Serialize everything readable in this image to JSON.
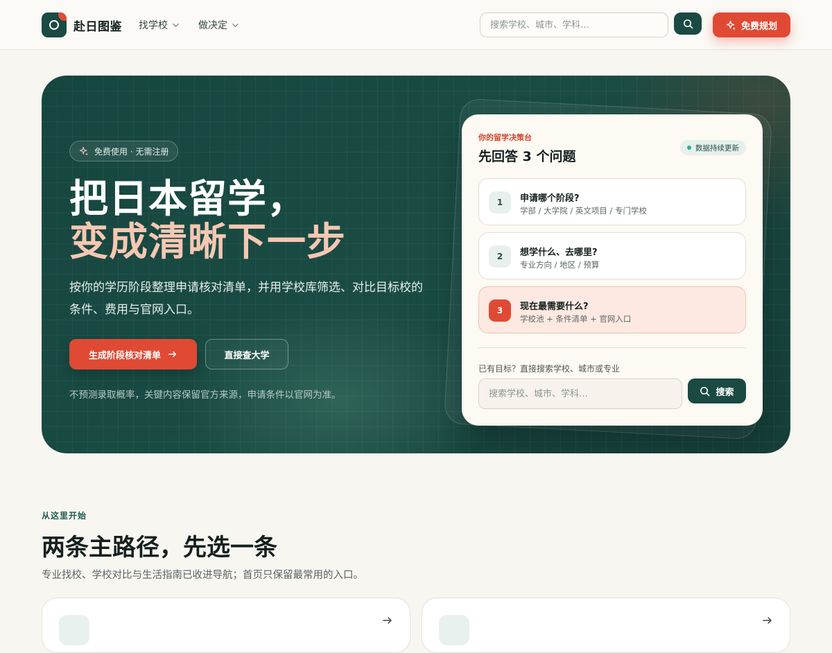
{
  "header": {
    "brand": "赴日图鉴",
    "nav": [
      {
        "label": "找学校"
      },
      {
        "label": "做决定"
      }
    ],
    "search_placeholder": "搜索学校、城市、学科…",
    "cta_label": "免费规划"
  },
  "hero": {
    "pill_text": "免费使用 · 无需注册",
    "title_line1": "把日本留学，",
    "title_line2": "变成清晰下一步",
    "description": "按你的学历阶段整理申请核对清单，并用学校库筛选、对比目标校的条件、费用与官网入口。",
    "primary_button": "生成阶段核对清单",
    "secondary_button": "直接查大学",
    "note": "不预测录取概率，关键内容保留官方来源，申请条件以官网为准。"
  },
  "decision_card": {
    "kicker": "你的留学决策台",
    "title": "先回答 3 个问题",
    "badge": "数据持续更新",
    "steps": [
      {
        "num": "1",
        "title": "申请哪个阶段?",
        "sub": "学部 / 大学院 / 英文项目 / 专门学校"
      },
      {
        "num": "2",
        "title": "想学什么、去哪里?",
        "sub": "专业方向 / 地区 / 预算"
      },
      {
        "num": "3",
        "title": "现在最需要什么?",
        "sub": "学校池 + 条件清单 + 官网入口"
      }
    ],
    "hint": "已有目标？直接搜索学校、城市或专业",
    "search_placeholder": "搜索学校、城市、学科…",
    "search_button": "搜索"
  },
  "section": {
    "kicker": "从这里开始",
    "title": "两条主路径，先选一条",
    "subtitle": "专业找校、学校对比与生活指南已收进导航；首页只保留最常用的入口。"
  },
  "colors": {
    "brand_green": "#1a4a42",
    "accent_red": "#e04a34",
    "highlight_peach": "#f6c7b3",
    "page_bg": "#f8f6f1"
  }
}
